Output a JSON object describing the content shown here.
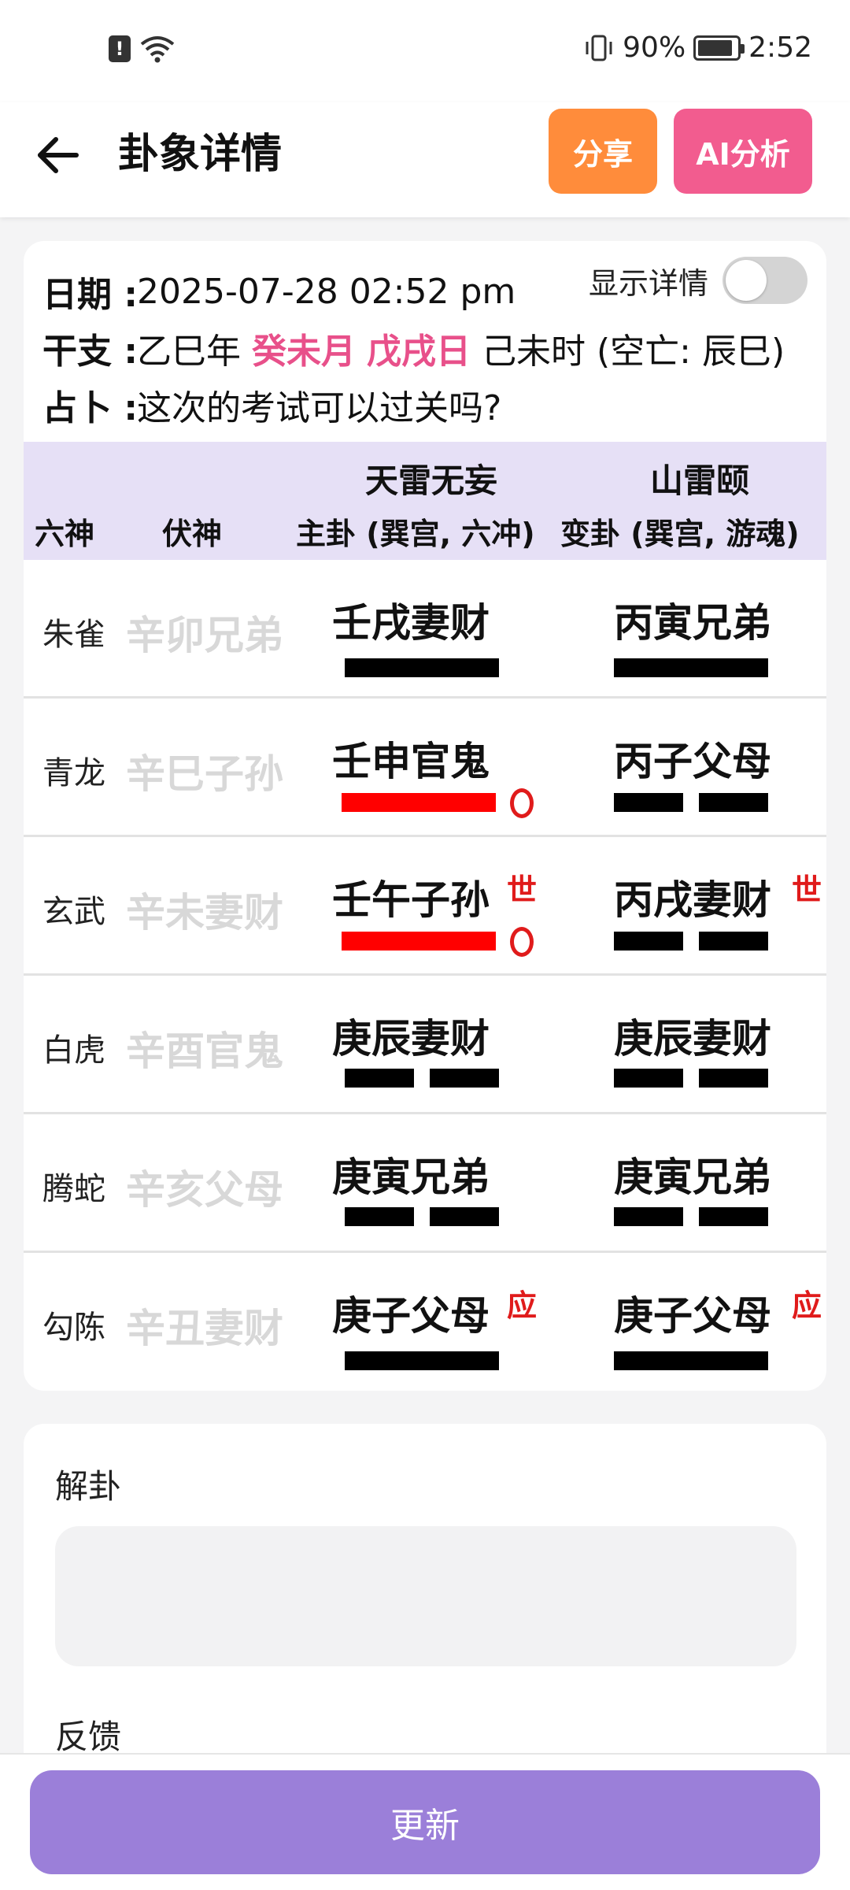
{
  "status_bar": {
    "vibrate_icon": "vibrate-icon",
    "battery_percent": "90%",
    "battery_level": 0.9,
    "time": "2:52"
  },
  "header": {
    "title": "卦象详情",
    "share_label": "分享",
    "ai_label": "AI分析"
  },
  "info": {
    "date_label": "日期 :",
    "date_value": "2025-07-28 02:52 pm",
    "toggle_label": "显示详情",
    "toggle_on": false,
    "ganzhi_label": "干支 :",
    "ganzhi_year": "乙巳年",
    "ganzhi_month": "癸未月",
    "ganzhi_day": "戊戌日",
    "ganzhi_rest": "己未时 (空亡: 辰巳)",
    "question_label": "占卜 :",
    "question_value": "这次的考试可以过关吗?"
  },
  "table": {
    "main_name": "天雷无妄",
    "changed_name": "山雷颐",
    "col_god": "六神",
    "col_hidden": "伏神",
    "col_main": "主卦 (巽宫, 六冲)",
    "col_changed": "变卦 (巽宫, 游魂)",
    "rows": [
      {
        "god": "朱雀",
        "hidden": "辛卯兄弟",
        "main": "壬戌妻财",
        "changed": "丙寅兄弟"
      },
      {
        "god": "青龙",
        "hidden": "辛巳子孙",
        "main": "壬申官鬼",
        "changed": "丙子父母"
      },
      {
        "god": "玄武",
        "hidden": "辛未妻财",
        "main": "壬午子孙",
        "main_mark": "世",
        "changed": "丙戌妻财",
        "changed_mark": "世"
      },
      {
        "god": "白虎",
        "hidden": "辛酉官鬼",
        "main": "庚辰妻财",
        "changed": "庚辰妻财"
      },
      {
        "god": "腾蛇",
        "hidden": "辛亥父母",
        "main": "庚寅兄弟",
        "changed": "庚寅兄弟"
      },
      {
        "god": "勾陈",
        "hidden": "辛丑妻财",
        "main": "庚子父母",
        "main_mark": "应",
        "changed": "庚子父母",
        "changed_mark": "应"
      }
    ]
  },
  "sections": {
    "interpret_label": "解卦",
    "feedback_label": "反馈"
  },
  "bottom": {
    "update_label": "更新"
  },
  "colors": {
    "share": "#ff8c3b",
    "ai": "#f25c8f",
    "ganzhi_highlight": "#e8508a",
    "table_header": "#e6e0f6",
    "moving_line": "#ff0000",
    "update": "#9b7fd9"
  }
}
